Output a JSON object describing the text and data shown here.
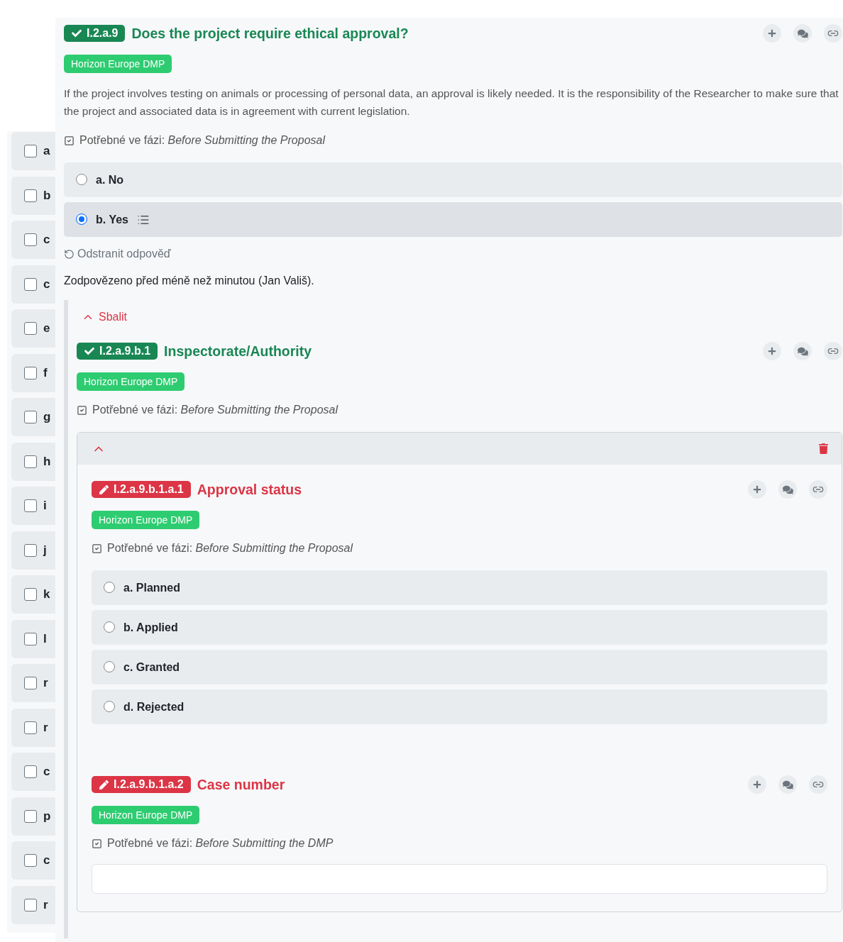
{
  "side_list": [
    {
      "label": "a",
      "checked": false
    },
    {
      "label": "b",
      "checked": false
    },
    {
      "label": "c",
      "checked": false
    },
    {
      "label": "c",
      "checked": false
    },
    {
      "label": "e",
      "checked": false
    },
    {
      "label": "f",
      "checked": false
    },
    {
      "label": "g",
      "checked": false
    },
    {
      "label": "h",
      "checked": false
    },
    {
      "label": "i",
      "checked": false
    },
    {
      "label": "j",
      "checked": false
    },
    {
      "label": "k",
      "checked": false
    },
    {
      "label": "l",
      "checked": false
    },
    {
      "label": "r",
      "checked": false
    },
    {
      "label": "r",
      "checked": false
    },
    {
      "label": "c",
      "checked": false
    },
    {
      "label": "p",
      "checked": false
    },
    {
      "label": "c",
      "checked": false
    },
    {
      "label": "r",
      "checked": false
    }
  ],
  "question": {
    "number": "I.2.a.9",
    "title": "Does the project require ethical approval?",
    "answered": true,
    "tag": "Horizon Europe DMP",
    "description": "If the project involves testing on animals or processing of personal data, an approval is likely needed. It is the responsibility of the Researcher to make sure that the project and associated data is in agreement with current legislation.",
    "phase_label": "Potřebné ve fázi:",
    "phase": "Before Submitting the Proposal",
    "kind": "options",
    "options": [
      {
        "label": "a. No",
        "selected": false,
        "has_followups": false
      },
      {
        "label": "b. Yes",
        "selected": true,
        "has_followups": true
      }
    ],
    "clear_label": "Odstranit odpověď",
    "answered_note": "Zodpovězeno před méně než minutou (Jan Vališ).",
    "followups": {
      "collapse_label": "Sbalit",
      "questions": [
        {
          "number": "I.2.a.9.b.1",
          "title": "Inspectorate/Authority",
          "answered": true,
          "tag": "Horizon Europe DMP",
          "phase_label": "Potřebné ve fázi:",
          "phase": "Before Submitting the Proposal",
          "kind": "list",
          "items": [
            {
              "expanded": true,
              "questions": [
                {
                  "number": "I.2.a.9.b.1.a.1",
                  "title": "Approval status",
                  "answered": false,
                  "tag": "Horizon Europe DMP",
                  "phase_label": "Potřebné ve fázi:",
                  "phase": "Before Submitting the Proposal",
                  "kind": "options",
                  "options": [
                    {
                      "label": "a. Planned",
                      "selected": false,
                      "has_followups": false
                    },
                    {
                      "label": "b. Applied",
                      "selected": false,
                      "has_followups": false
                    },
                    {
                      "label": "c. Granted",
                      "selected": false,
                      "has_followups": false
                    },
                    {
                      "label": "d. Rejected",
                      "selected": false,
                      "has_followups": false
                    }
                  ]
                },
                {
                  "number": "I.2.a.9.b.1.a.2",
                  "title": "Case number",
                  "answered": false,
                  "tag": "Horizon Europe DMP",
                  "phase_label": "Potřebné ve fázi:",
                  "phase": "Before Submitting the DMP",
                  "kind": "text"
                }
              ]
            }
          ]
        }
      ]
    }
  }
}
